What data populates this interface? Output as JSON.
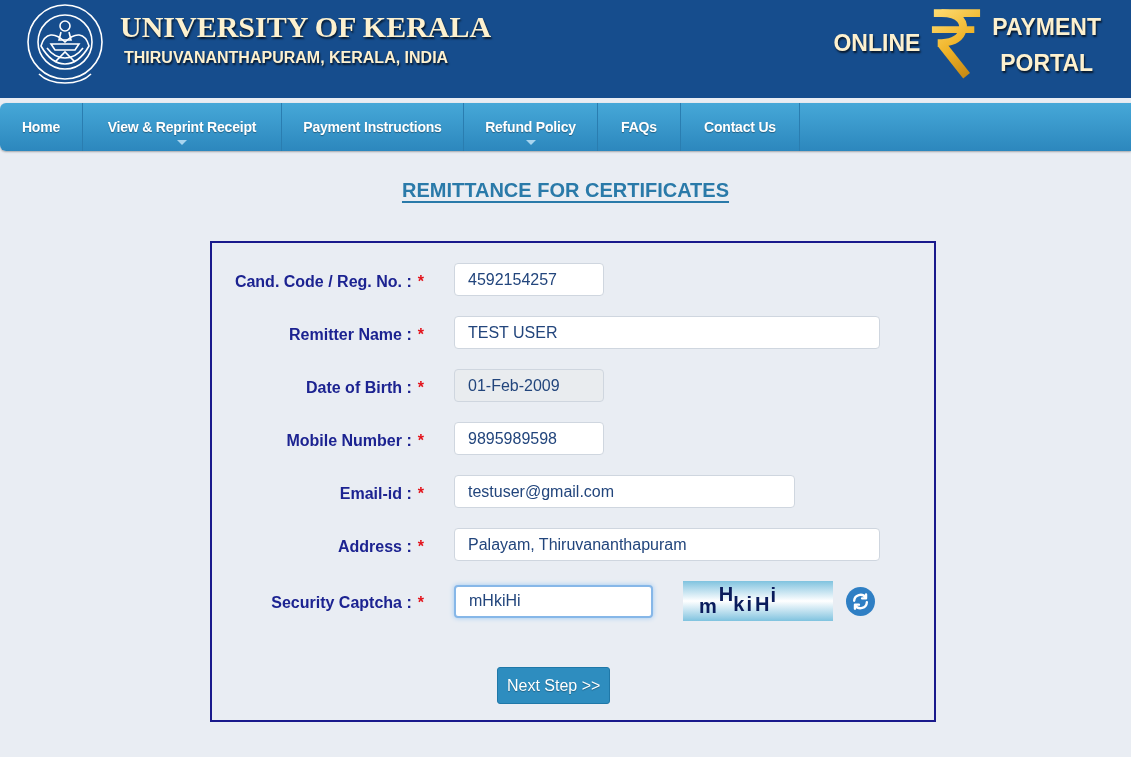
{
  "header": {
    "title": "UNIVERSITY OF KERALA",
    "subtitle": "THIRUVANANTHAPURAM, KERALA, INDIA",
    "portal_badge": {
      "left": "ONLINE",
      "top": "PAYMENT",
      "bottom": "PORTAL"
    }
  },
  "nav": {
    "items": [
      {
        "label": "Home",
        "has_submenu": false
      },
      {
        "label": "View & Reprint Receipt",
        "has_submenu": true
      },
      {
        "label": "Payment Instructions",
        "has_submenu": false
      },
      {
        "label": "Refund Policy",
        "has_submenu": true
      },
      {
        "label": "FAQs",
        "has_submenu": false
      },
      {
        "label": "Contact Us",
        "has_submenu": false
      }
    ]
  },
  "page_title": "REMITTANCE FOR CERTIFICATES",
  "form": {
    "fields": [
      {
        "kind": "text",
        "label": "Cand. Code / Reg. No. :",
        "required_mark": "*",
        "value": "4592154257",
        "disabled": false,
        "focused": false
      },
      {
        "kind": "text",
        "label": "Remitter Name :",
        "required_mark": "*",
        "value": "TEST USER",
        "disabled": false,
        "focused": false
      },
      {
        "kind": "text",
        "label": "Date of Birth :",
        "required_mark": "*",
        "value": "01-Feb-2009",
        "disabled": true,
        "focused": false
      },
      {
        "kind": "text",
        "label": "Mobile Number :",
        "required_mark": "*",
        "value": "9895989598",
        "disabled": false,
        "focused": false
      },
      {
        "kind": "text",
        "label": "Email-id :",
        "required_mark": "*",
        "value": "testuser@gmail.com",
        "disabled": false,
        "focused": false
      },
      {
        "kind": "text",
        "label": "Address :",
        "required_mark": "*",
        "value": "Palayam, Thiruvananthapuram",
        "disabled": false,
        "focused": false
      },
      {
        "kind": "captcha",
        "label": "Security Captcha :",
        "required_mark": "*",
        "value": "mHkiHi",
        "disabled": false,
        "focused": true,
        "captcha_image": "mHkiHi"
      }
    ],
    "submit_button": "Next Step >>"
  }
}
